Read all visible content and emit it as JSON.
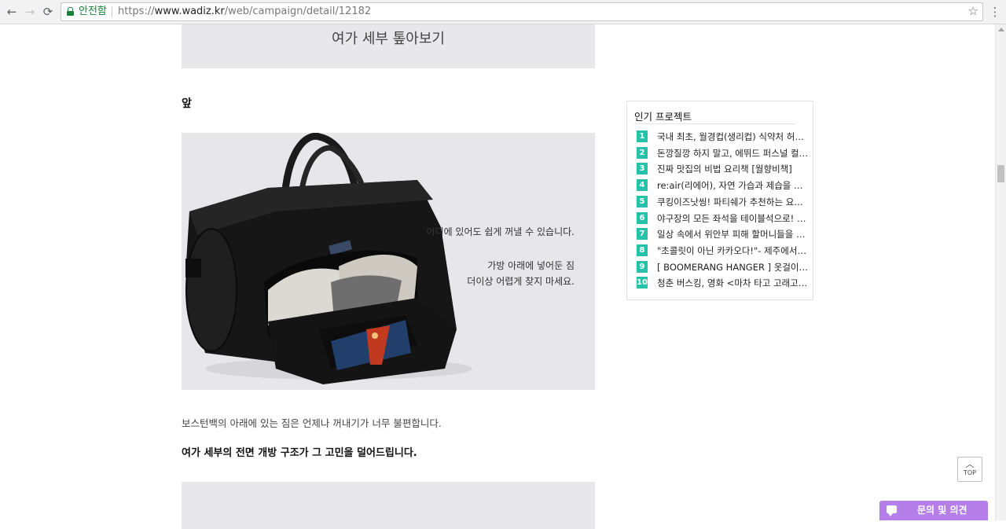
{
  "browser": {
    "secure_label": "안전함",
    "url_scheme": "https://",
    "url_host": "www.wadiz.kr",
    "url_path": "/web/campaign/detail/12182",
    "back_icon": "back-arrow-icon",
    "forward_icon": "forward-arrow-icon",
    "reload_icon": "reload-icon",
    "bookmark_icon": "star-icon",
    "menu_icon": "kebab-menu-icon"
  },
  "content": {
    "section_title": "여가 세부 톺아보기",
    "sub_heading": "앞",
    "image_caption_1": "어디에 있어도 쉽게 꺼낼 수 있습니다.",
    "image_caption_2": "가방 아래에 넣어둔 짐",
    "image_caption_3": "더이상 어렵게 찾지 마세요.",
    "bag_tag": "TRAVELUS",
    "body_text": "보스턴백의 아래에 있는 짐은 언제나 꺼내기가 너무 불편합니다.",
    "bold_text": "여가 세부의 전면 개방 구조가 그 고민을 덜어드립니다."
  },
  "sidebar": {
    "title": "인기 프로젝트",
    "items": [
      {
        "rank": "1",
        "text": "국내 최초, 월경컵(생리컵) 식약처 허가를..."
      },
      {
        "rank": "2",
        "text": "돈깡질깡 하지 말고, 에뛰드 퍼스널 컬러..."
      },
      {
        "rank": "3",
        "text": "진짜 맛집의 비법 요리책 [월향비책]"
      },
      {
        "rank": "4",
        "text": "re:air(리에어), 자연 가습과 제습을 한번..."
      },
      {
        "rank": "5",
        "text": "쿠킹이즈낫씽! 파티쉐가 추천하는 요리 ..."
      },
      {
        "rank": "6",
        "text": "야구장의 모든 좌석을 테이블석으로! \"스..."
      },
      {
        "rank": "7",
        "text": "일상 속에서 위안부 피해 할머니들을 기..."
      },
      {
        "rank": "8",
        "text": "\"초콜릿이 아닌 카카오다!\"- 제주에서 만..."
      },
      {
        "rank": "9",
        "text": "[ BOOMERANG HANGER ] 옷걸이는 뭔..."
      },
      {
        "rank": "10",
        "text": "청춘 버스킹, 영화 <마차 타고 고래고래>"
      }
    ]
  },
  "floating": {
    "top_label": "TOP",
    "inquiry_label": "문의 및 의견"
  },
  "colors": {
    "rank_badge": "#24c2a8",
    "inquiry_button": "#b57ee8",
    "secure_green": "#188038",
    "title_box_bg": "#e8e8ea"
  }
}
